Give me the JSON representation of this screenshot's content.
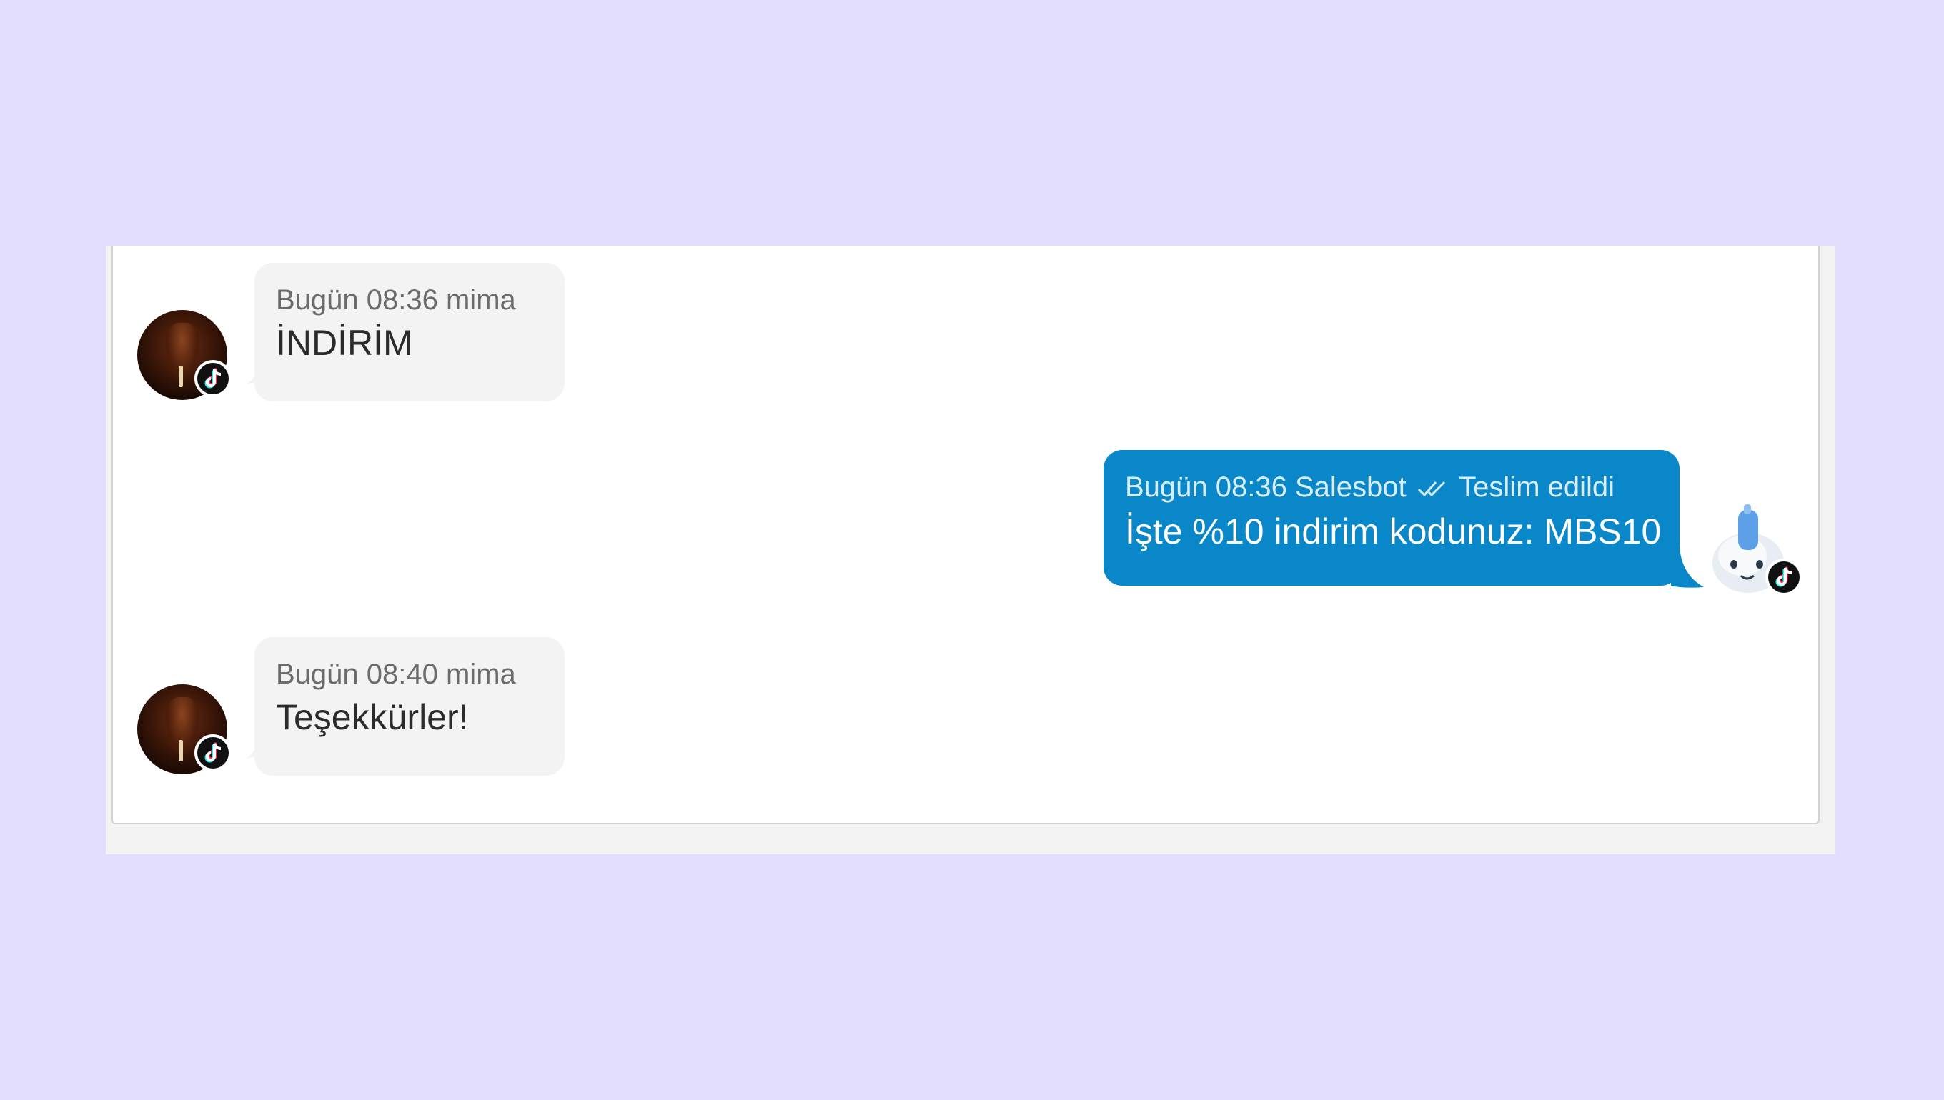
{
  "messages": [
    {
      "meta": "Bugün 08:36 mima",
      "text": "İNDİRİM"
    },
    {
      "meta_time": "Bugün 08:36 Salesbot",
      "meta_status": "Teslim edildi",
      "text": "İşte %10 indirim kodunuz: MBS10"
    },
    {
      "meta": "Bugün 08:40 mima",
      "text": "Teşekkürler!"
    }
  ],
  "icons": {
    "channel": "tiktok-icon",
    "delivered": "double-check-icon",
    "bot": "robot-avatar-icon",
    "user": "user-avatar-icon"
  },
  "colors": {
    "page_background": "#e4defe",
    "incoming_bubble": "#f3f3f3",
    "outgoing_bubble": "#0a87c9"
  }
}
